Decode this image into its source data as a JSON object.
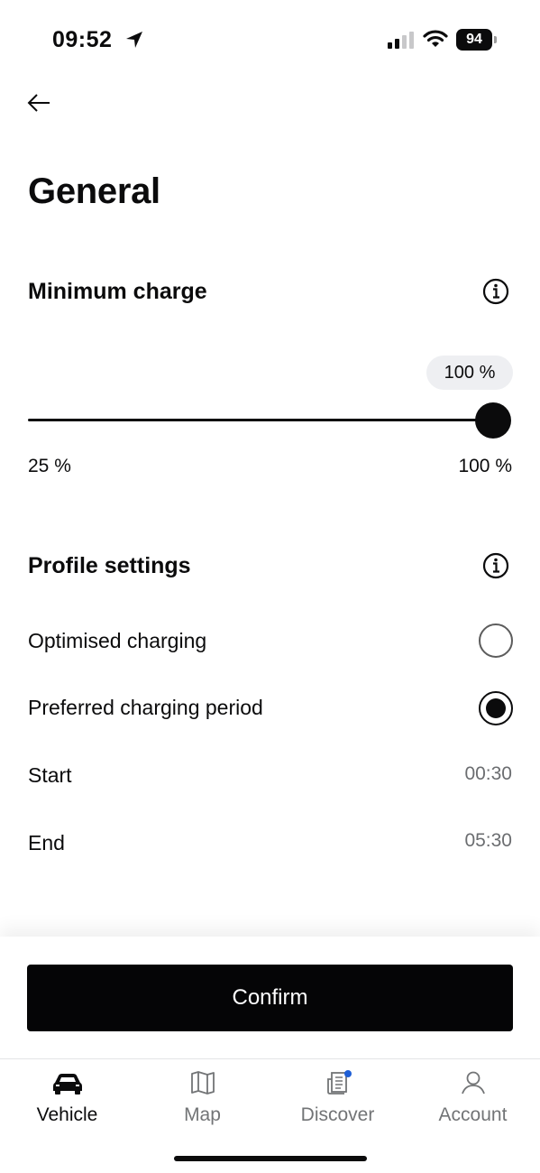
{
  "status_bar": {
    "time": "09:52",
    "battery": "94",
    "icons": [
      "location-arrow-icon",
      "cellular-signal-icon",
      "wifi-icon",
      "battery-icon"
    ]
  },
  "header": {
    "back_icon": "arrow-left-icon",
    "title": "General"
  },
  "minimum_charge": {
    "title": "Minimum charge",
    "info_icon": "info-icon",
    "slider": {
      "value_label": "100 %",
      "value_percent": 100,
      "min_label": "25 %",
      "max_label": "100 %"
    }
  },
  "profile_settings": {
    "title": "Profile settings",
    "info_icon": "info-icon",
    "options": [
      {
        "label": "Optimised charging",
        "selected": false
      },
      {
        "label": "Preferred charging period",
        "selected": true
      }
    ],
    "start": {
      "label": "Start",
      "value": "00:30"
    },
    "end": {
      "label": "End",
      "value": "05:30"
    }
  },
  "confirm_label": "Confirm",
  "tabs": [
    {
      "label": "Vehicle",
      "icon": "car-icon",
      "active": true
    },
    {
      "label": "Map",
      "icon": "map-icon",
      "active": false
    },
    {
      "label": "Discover",
      "icon": "news-icon",
      "active": false,
      "badge": true
    },
    {
      "label": "Account",
      "icon": "user-icon",
      "active": false
    }
  ],
  "colors": {
    "primary": "#0b0b0c",
    "muted_text": "#6b6d70",
    "bubble_bg": "#eeeff2",
    "badge": "#1f5fd6"
  }
}
